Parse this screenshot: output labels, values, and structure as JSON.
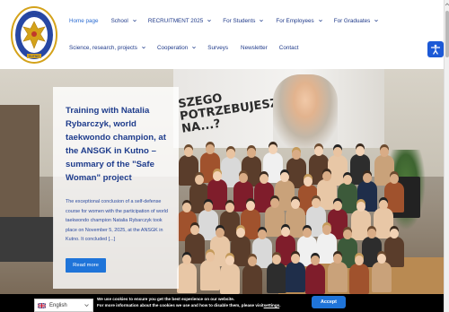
{
  "nav": {
    "row1": [
      {
        "label": "Home page",
        "active": true,
        "dropdown": false
      },
      {
        "label": "School",
        "active": false,
        "dropdown": true
      },
      {
        "label": "RECRUITMENT 2025",
        "active": false,
        "dropdown": true
      },
      {
        "label": "For Students",
        "active": false,
        "dropdown": true
      },
      {
        "label": "For Employees",
        "active": false,
        "dropdown": true
      },
      {
        "label": "For Graduates",
        "active": false,
        "dropdown": true
      }
    ],
    "row2": [
      {
        "label": "Science, research, projects",
        "active": false,
        "dropdown": true
      },
      {
        "label": "Cooperation",
        "active": false,
        "dropdown": true
      },
      {
        "label": "Surveys",
        "active": false,
        "dropdown": false
      },
      {
        "label": "Newsletter",
        "active": false,
        "dropdown": false
      },
      {
        "label": "Contact",
        "active": false,
        "dropdown": false
      }
    ]
  },
  "logo": {
    "icon": "university-crest-icon",
    "top_text": "WYDZIAŁ",
    "bottom_text": "KUTNO"
  },
  "accessibility": {
    "icon": "accessibility-icon"
  },
  "hero": {
    "screen_text": "SZEGO\nPOTRZEBUJESZ,\nNA...?",
    "card": {
      "title": "Training with Natalia Rybarczyk, world taekwondo champion, at the ANSGK in Kutno – summary of the \"Safe Woman\" project",
      "excerpt": "The exceptional conclusion of a self-defense course for women with the participation of world taekwondo champion Natalia Rybarczyk took place on November 5, 2025, at the ANSGK in Kutno. It concluded [...]",
      "button": "Read more"
    }
  },
  "cookie": {
    "line1": "We use cookies to ensure you get the best experience on our website.",
    "line2_prefix": "For more information about the cookies we use and how to disable them, please visit",
    "line2_link": "settings",
    "line2_suffix": ".",
    "accept": "Accept"
  },
  "language": {
    "selected": "English",
    "flag_icon": "uk-flag-icon"
  },
  "colors": {
    "nav_text": "#1f3a8a",
    "nav_active": "#2a6bd1",
    "button_blue": "#1f74d9",
    "card_title": "#1e3c8c"
  }
}
